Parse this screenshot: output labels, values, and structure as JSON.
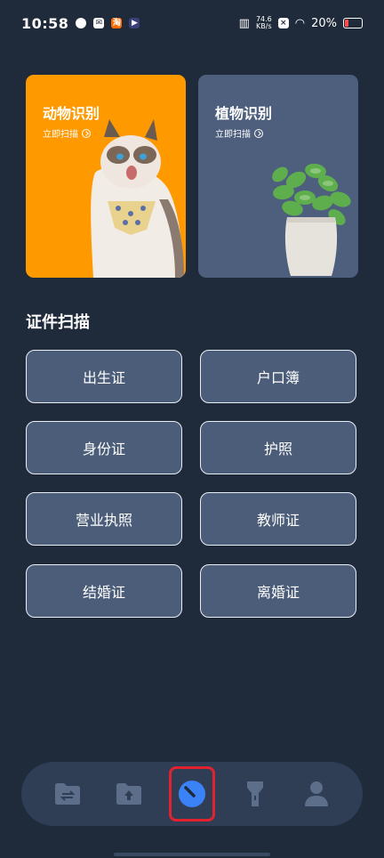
{
  "status_bar": {
    "time": "10:58",
    "network_speed_value": "74.6",
    "network_speed_unit": "KB/s",
    "battery": "20%"
  },
  "cards": [
    {
      "title": "动物识别",
      "subtitle": "立即扫描"
    },
    {
      "title": "植物识别",
      "subtitle": "立即扫描"
    }
  ],
  "section": {
    "title": "证件扫描"
  },
  "documents": [
    "出生证",
    "户口簿",
    "身份证",
    "护照",
    "营业执照",
    "教师证",
    "结婚证",
    "离婚证"
  ],
  "nav": {
    "items": [
      "file-transfer-icon",
      "upload-folder-icon",
      "scan-dial-icon",
      "flashlight-icon",
      "profile-icon"
    ],
    "active_index": 2
  },
  "colors": {
    "background": "#1f2a3a",
    "animal_card": "#ff9900",
    "plant_card": "#4d5f7d",
    "button_fill": "#4b5d79",
    "nav_active": "#3b82f6",
    "highlight": "#e2232f"
  }
}
